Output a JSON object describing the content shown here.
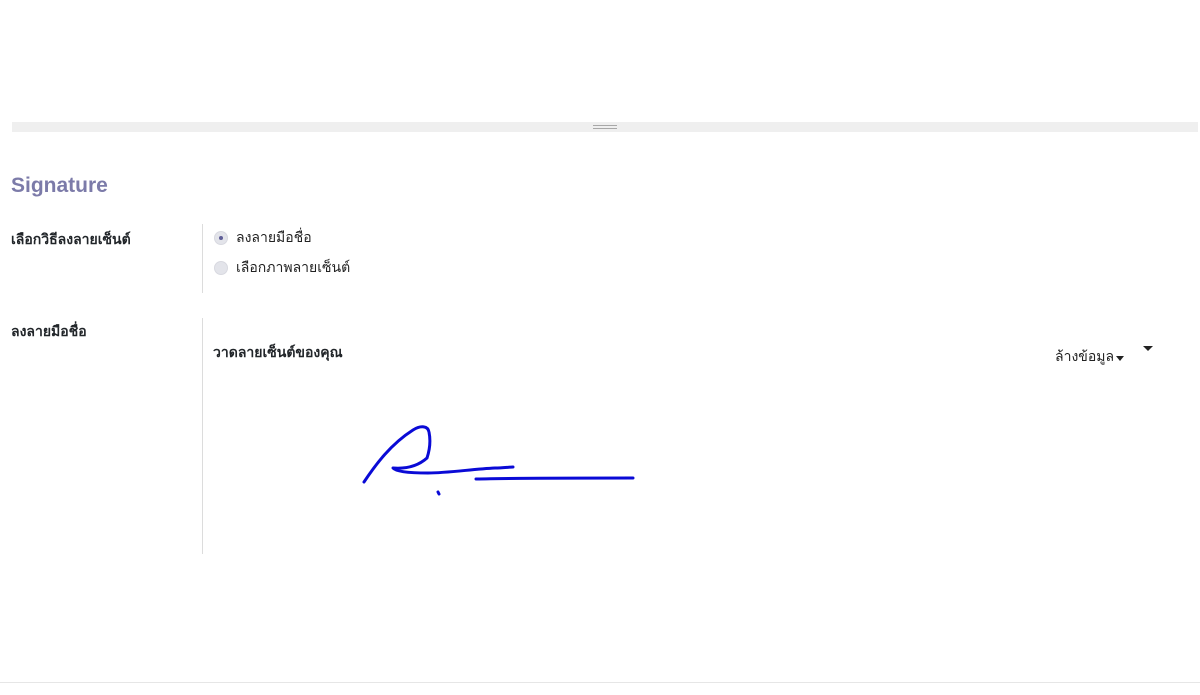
{
  "section": {
    "title": "Signature"
  },
  "signature_method": {
    "label": "เลือกวิธีลงลายเซ็นต์",
    "options": [
      {
        "label": "ลงลายมือชื่อ",
        "selected": true
      },
      {
        "label": "เลือกภาพลายเซ็นต์",
        "selected": false
      }
    ]
  },
  "draw_signature": {
    "label": "ลงลายมือชื่อ",
    "canvas_title": "วาดลายเซ็นต์ของคุณ",
    "clear_label": "ล้างข้อมูล",
    "stroke_color": "#0a0ad6"
  },
  "colors": {
    "section_title": "#7c7ba9",
    "radio_accent": "#5f5e97"
  }
}
